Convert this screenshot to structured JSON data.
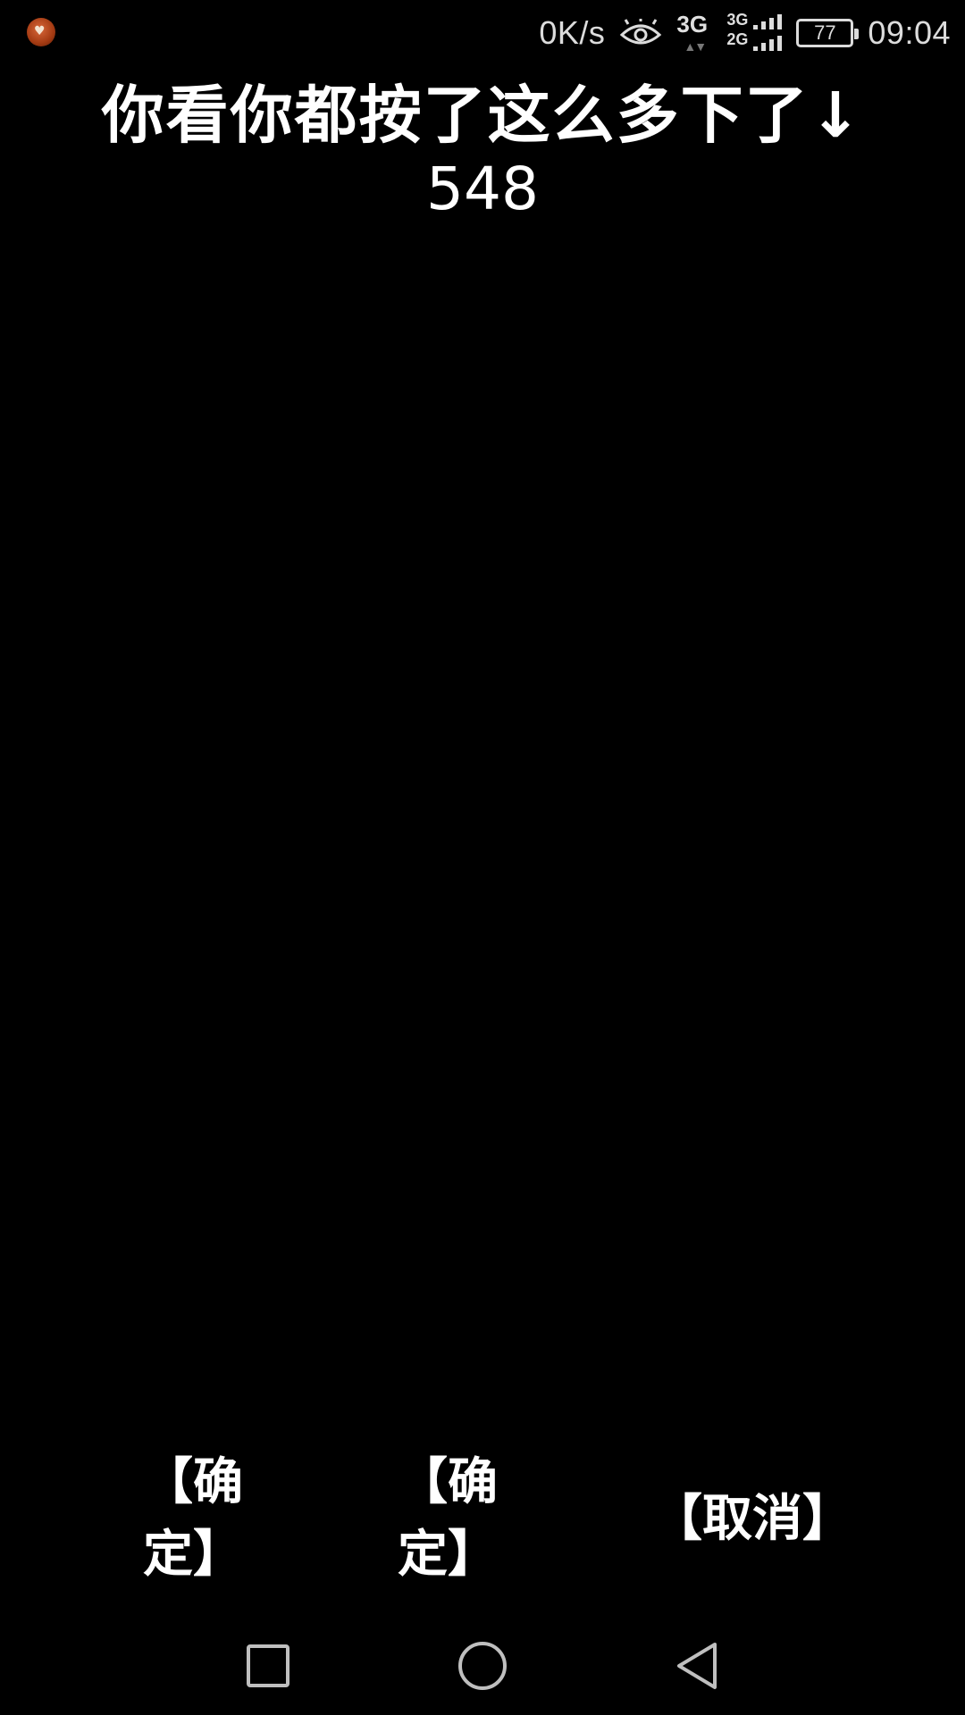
{
  "status_bar": {
    "net_speed": "0K/s",
    "net_type": "3G",
    "sim_networks": [
      "3G",
      "2G"
    ],
    "battery": "77",
    "time": "09:04",
    "icons": [
      "app-notification-icon",
      "eye-icon",
      "signal-icon",
      "battery-icon"
    ]
  },
  "main": {
    "title": "你看你都按了这么多下了↓",
    "count": "548"
  },
  "buttons": {
    "confirm1": "【确定】",
    "confirm2": "【确定】",
    "cancel": "【取消】"
  },
  "nav": {
    "icons": [
      "recent-apps-icon",
      "home-icon",
      "back-icon"
    ]
  }
}
